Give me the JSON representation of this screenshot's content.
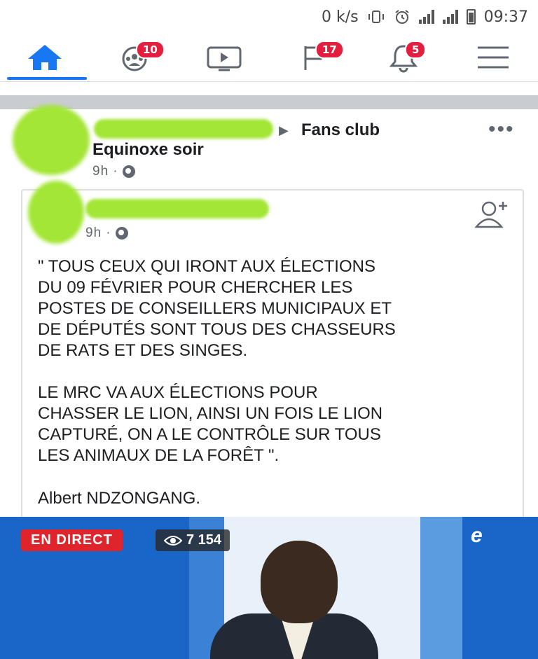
{
  "status_bar": {
    "speed": "0 k/s",
    "time": "09:37"
  },
  "nav": {
    "groups_badge": "10",
    "pages_badge": "17",
    "notifications_badge": "5"
  },
  "post": {
    "group_name": "Fans club",
    "page_name": "Equinoxe soir",
    "time": "9h ·"
  },
  "shared": {
    "time": "9h ·",
    "quote_lines_1": [
      "\" TOUS CEUX QUI IRONT AUX ÉLECTIONS",
      "DU 09 FÉVRIER POUR CHERCHER LES",
      "POSTES DE CONSEILLERS MUNICIPAUX ET",
      "DE DÉPUTÉS SONT TOUS DES CHASSEURS",
      "DE RATS ET DES SINGES."
    ],
    "quote_lines_2": [
      "LE MRC VA AUX ÉLECTIONS POUR",
      "CHASSER LE LION, AINSI UN FOIS LE LION",
      "CAPTURÉ, ON A LE CONTRÔLE SUR TOUS",
      "LES ANIMAUX DE LA FORÊT \"."
    ],
    "author": "Albert NDZONGANG."
  },
  "video": {
    "live_label": "EN DIRECT",
    "views": "7 154",
    "channel_logo": "e"
  },
  "colors": {
    "facebook_blue": "#1877f2",
    "badge_red": "#e41e3f",
    "live_red": "#e0242b",
    "redaction_green": "#a3e635"
  }
}
